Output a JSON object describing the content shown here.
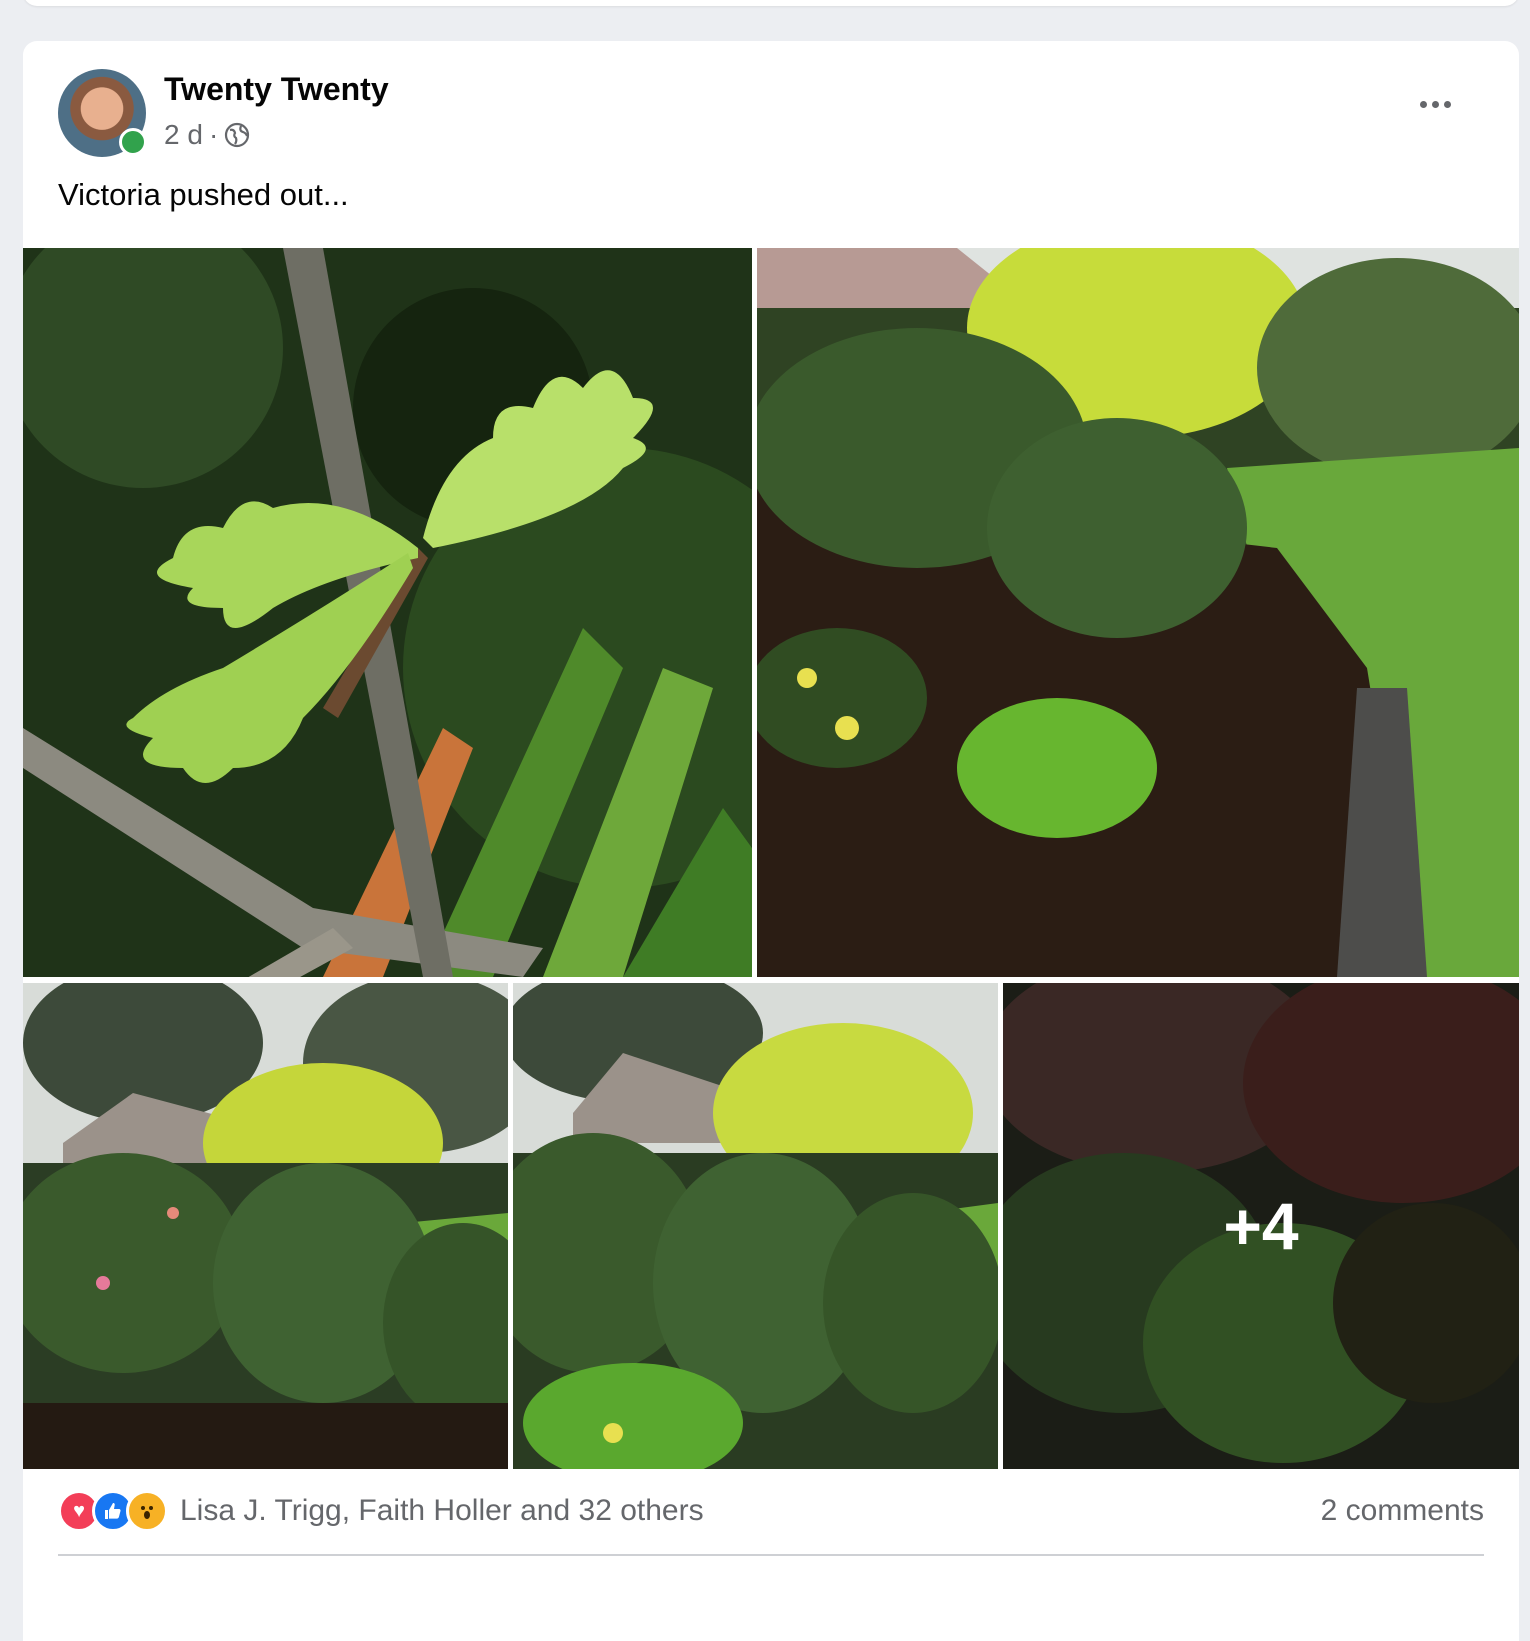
{
  "post": {
    "author": "Twenty Twenty",
    "time": "2 d",
    "separator": "·",
    "text": "Victoria pushed out...",
    "more_photos_label": "+4",
    "reactions_summary": "Lisa J. Trigg, Faith Holler and 32 others",
    "comments_count": "2 comments",
    "reaction_types": [
      "love-icon",
      "like-icon",
      "wow-icon"
    ]
  },
  "colors": {
    "online": "#31a24c",
    "love": "#f33e58",
    "like": "#1877f2",
    "wow": "#f7b125"
  }
}
